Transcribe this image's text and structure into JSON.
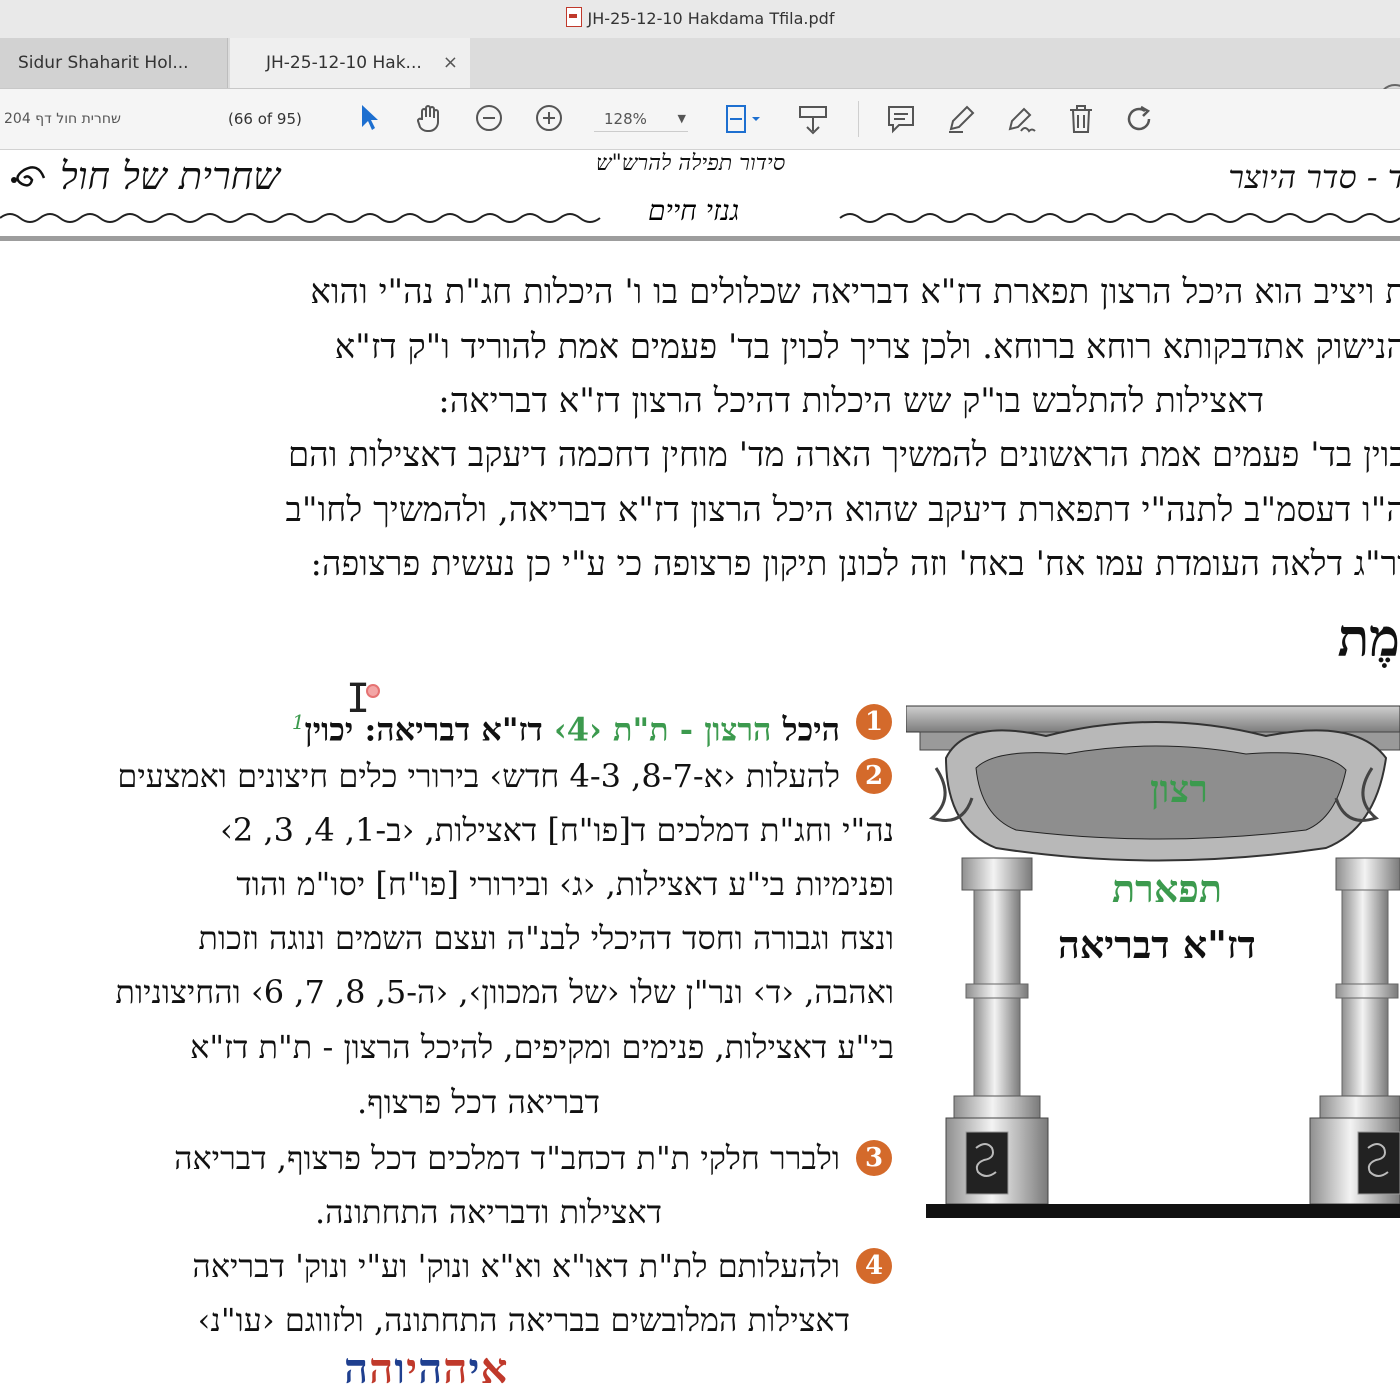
{
  "window": {
    "title": "JH-25-12-10 Hakdama Tfila.pdf",
    "help_label": "?"
  },
  "tabs": [
    {
      "label": "Sidur Shaharit Hol..."
    },
    {
      "label": "JH-25-12-10 Hak...",
      "close": "×"
    }
  ],
  "toolbar": {
    "page_field": "שחרית חול דף 204",
    "page_count": "(66 of 95)",
    "zoom": "128%",
    "icons": [
      "select-arrow-icon",
      "hand-icon",
      "zoom-out-icon",
      "zoom-in-icon",
      "fit-page-icon",
      "scroll-mode-icon",
      "comment-icon",
      "pen-icon",
      "sign-icon",
      "trash-icon",
      "rotate-icon"
    ]
  },
  "page_header": {
    "left": "שחרית של חול",
    "right": "רד - סדר היוצר",
    "arc": "סידור תפילה להרש\"ש",
    "center": "גנזי חיים"
  },
  "paragraph": [
    "ת ויציב הוא היכל הרצון תפארת דז\"א דבריאה שכלולים בו ו' היכלות חג\"ת נה\"י והוא",
    "הנישוק אתדבקותא רוחא ברוחא. ולכן צריך לכוין בד' פעמים אמת להוריד ו\"ק דז\"א",
    "דאצילות להתלבש בו\"ק שש היכלות דהיכל הרצון דז\"א דבריאה:",
    "כוין בד' פעמים אמת הראשונים להמשיך הארה מד' מוחין דחכמה דיעקב דאצילות והם",
    "ה\"ו דעסמ\"ב לתנה\"י דתפארת דיעקב שהוא היכל הרצון דז\"א דבריאה, ולהמשיך לחו\"ב",
    "ור\"ג דלאה העומדת עמו אח' באח' וזה לכונן תיקון פרצופה כי ע\"י כן נעשית פרצופה:"
  ],
  "heading": "מֶת",
  "list": [
    {
      "num": "1",
      "lines": [
        {
          "a": "היכל ",
          "g": "הרצון - ת\"ת ‹4›",
          "b": " דז\"א דבריאה: יכוין",
          "sup": "1"
        }
      ]
    },
    {
      "num": "2",
      "lines": [
        "להעלות ‹א-8-7, 4-3 חדש› בירורי כלים חיצונים ואמצעים",
        "נה\"י וחג\"ת דמלכים ד[פו\"ח] דאצילות, ‹ב-1, 4, 3, 2›",
        "ופנימיות בי\"ע דאצילות, ‹ג› ובירורי [פו\"ח] יסו\"מ והוד",
        "ונצח וגבורה וחסד דהיכלי לבנ\"ה ועצם השמים ונוגה וזכות",
        "ואהבה, ‹ד› ונר\"ן שלו ‹של המכוון›, ‹ה-5, 8, 7, 6› והחיצוניות",
        "בי\"ע דאצילות, פנימים ומקיפים, להיכל הרצון - ת\"ת דז\"א",
        "דבריאה דכל פרצוף."
      ]
    },
    {
      "num": "3",
      "lines": [
        "ולברר חלקי ת\"ת דכחב\"ד דמלכים דכל פרצוף, דבריאה",
        "דאצילות ודבריאה התחתונה."
      ]
    },
    {
      "num": "4",
      "lines": [
        "ולהעלותם לת\"ת דאו\"א וא\"א ונוק' וע\"י ונוק' דבריאה",
        "דאצילות המלובשים בבריאה התחתונה, ולזווגם ‹עו\"נ›"
      ]
    }
  ],
  "illustration": {
    "top_label": "רצון",
    "mid_label": "תפארת",
    "bottom_label": "דז\"א דבריאה"
  },
  "name_letters": [
    "א",
    "י",
    "ה",
    "ה",
    "י",
    "ו",
    "ה",
    "ה"
  ],
  "colors": {
    "green": "#3c9a4e",
    "blue": "#1d6fa8",
    "badge": "#d46a2b",
    "name_red": "#c0392b",
    "name_blue": "#1f3f8f"
  }
}
